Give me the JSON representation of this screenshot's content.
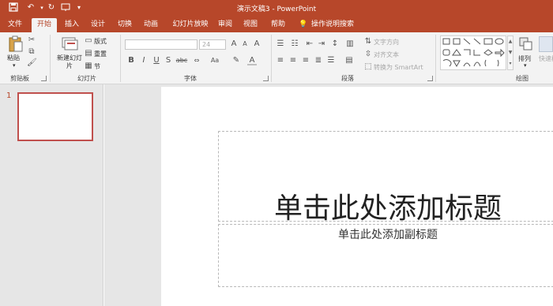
{
  "window": {
    "title": "演示文稿3 - PowerPoint",
    "accent": "#b7472a"
  },
  "tabs": [
    {
      "label": "文件"
    },
    {
      "label": "开始",
      "active": true
    },
    {
      "label": "插入"
    },
    {
      "label": "设计"
    },
    {
      "label": "切换"
    },
    {
      "label": "动画"
    },
    {
      "label": "幻灯片放映"
    },
    {
      "label": "审阅"
    },
    {
      "label": "视图"
    },
    {
      "label": "帮助"
    }
  ],
  "tell_me": {
    "label": "操作说明搜索"
  },
  "ribbon": {
    "clipboard": {
      "paste": "粘贴",
      "group": "剪贴板"
    },
    "slides": {
      "new_slide": "新建幻灯片",
      "layout": "版式",
      "reset": "重置",
      "section": "节",
      "group": "幻灯片"
    },
    "font": {
      "size": "24",
      "bold": "B",
      "italic": "I",
      "underline": "U",
      "strike": "S",
      "spacing": "abc",
      "change_case": "Aa",
      "color": "A",
      "grow": "A",
      "shrink": "A",
      "clear": "A",
      "group": "字体"
    },
    "paragraph": {
      "text_direction": "文字方向",
      "align_text": "对齐文本",
      "smartart": "转换为 SmartArt",
      "group": "段落"
    },
    "drawing": {
      "arrange": "排列",
      "quick_styles": "快速样式",
      "group": "绘图"
    }
  },
  "slide_pane": {
    "slide_number": "1"
  },
  "slide": {
    "title_placeholder": "单击此处添加标题",
    "subtitle_placeholder": "单击此处添加副标题"
  }
}
